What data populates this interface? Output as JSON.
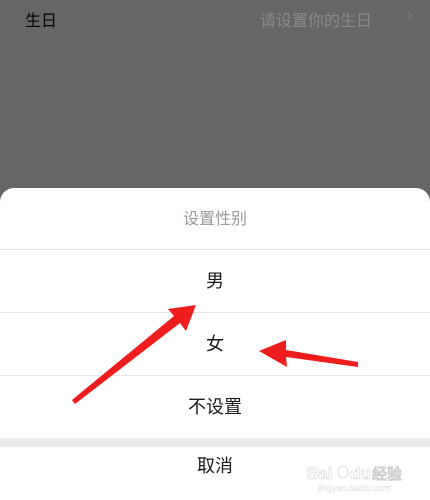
{
  "background": {
    "birthday_label": "生日",
    "birthday_placeholder": "请设置你的生日",
    "chevron": "chevron-right-icon"
  },
  "sheet": {
    "title": "设置性别",
    "options": [
      "男",
      "女",
      "不设置"
    ],
    "cancel": "取消"
  },
  "annotation_color": "#ee1c1c",
  "overlay_color": "#666666",
  "watermark": {
    "brand": "Bai du",
    "suffix": "经验",
    "url": "jingyan.baidu.com"
  }
}
